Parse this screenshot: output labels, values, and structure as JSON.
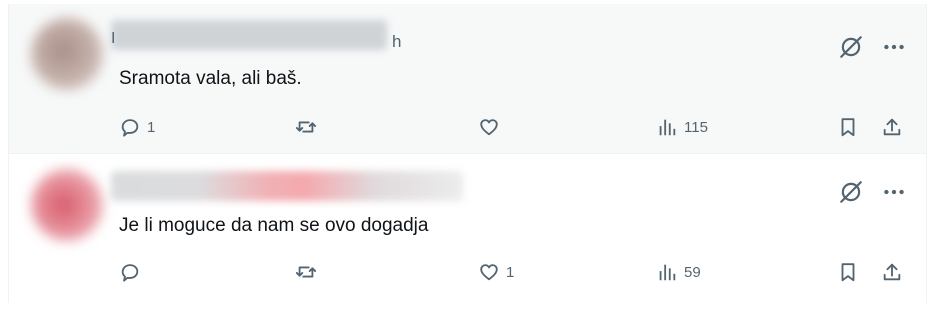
{
  "posts": [
    {
      "name_initial": "I",
      "time": "h",
      "text": "Sramota vala, ali baš.",
      "reply_count": "1",
      "retweet_count": "",
      "like_count": "",
      "views_count": "115"
    },
    {
      "name_initial": "",
      "time": "",
      "text": "Je li moguce da nam se ovo dogadja",
      "reply_count": "",
      "retweet_count": "",
      "like_count": "1",
      "views_count": "59"
    }
  ],
  "icons": {
    "top": [
      "grok-icon",
      "more-icon"
    ],
    "actions": [
      "reply-icon",
      "retweet-icon",
      "like-icon",
      "views-icon",
      "bookmark-icon",
      "share-icon"
    ]
  },
  "colors": {
    "text": "#0f1419",
    "secondary": "#536471",
    "hover_bg": "#f7f9f9",
    "border": "#eff3f4"
  }
}
